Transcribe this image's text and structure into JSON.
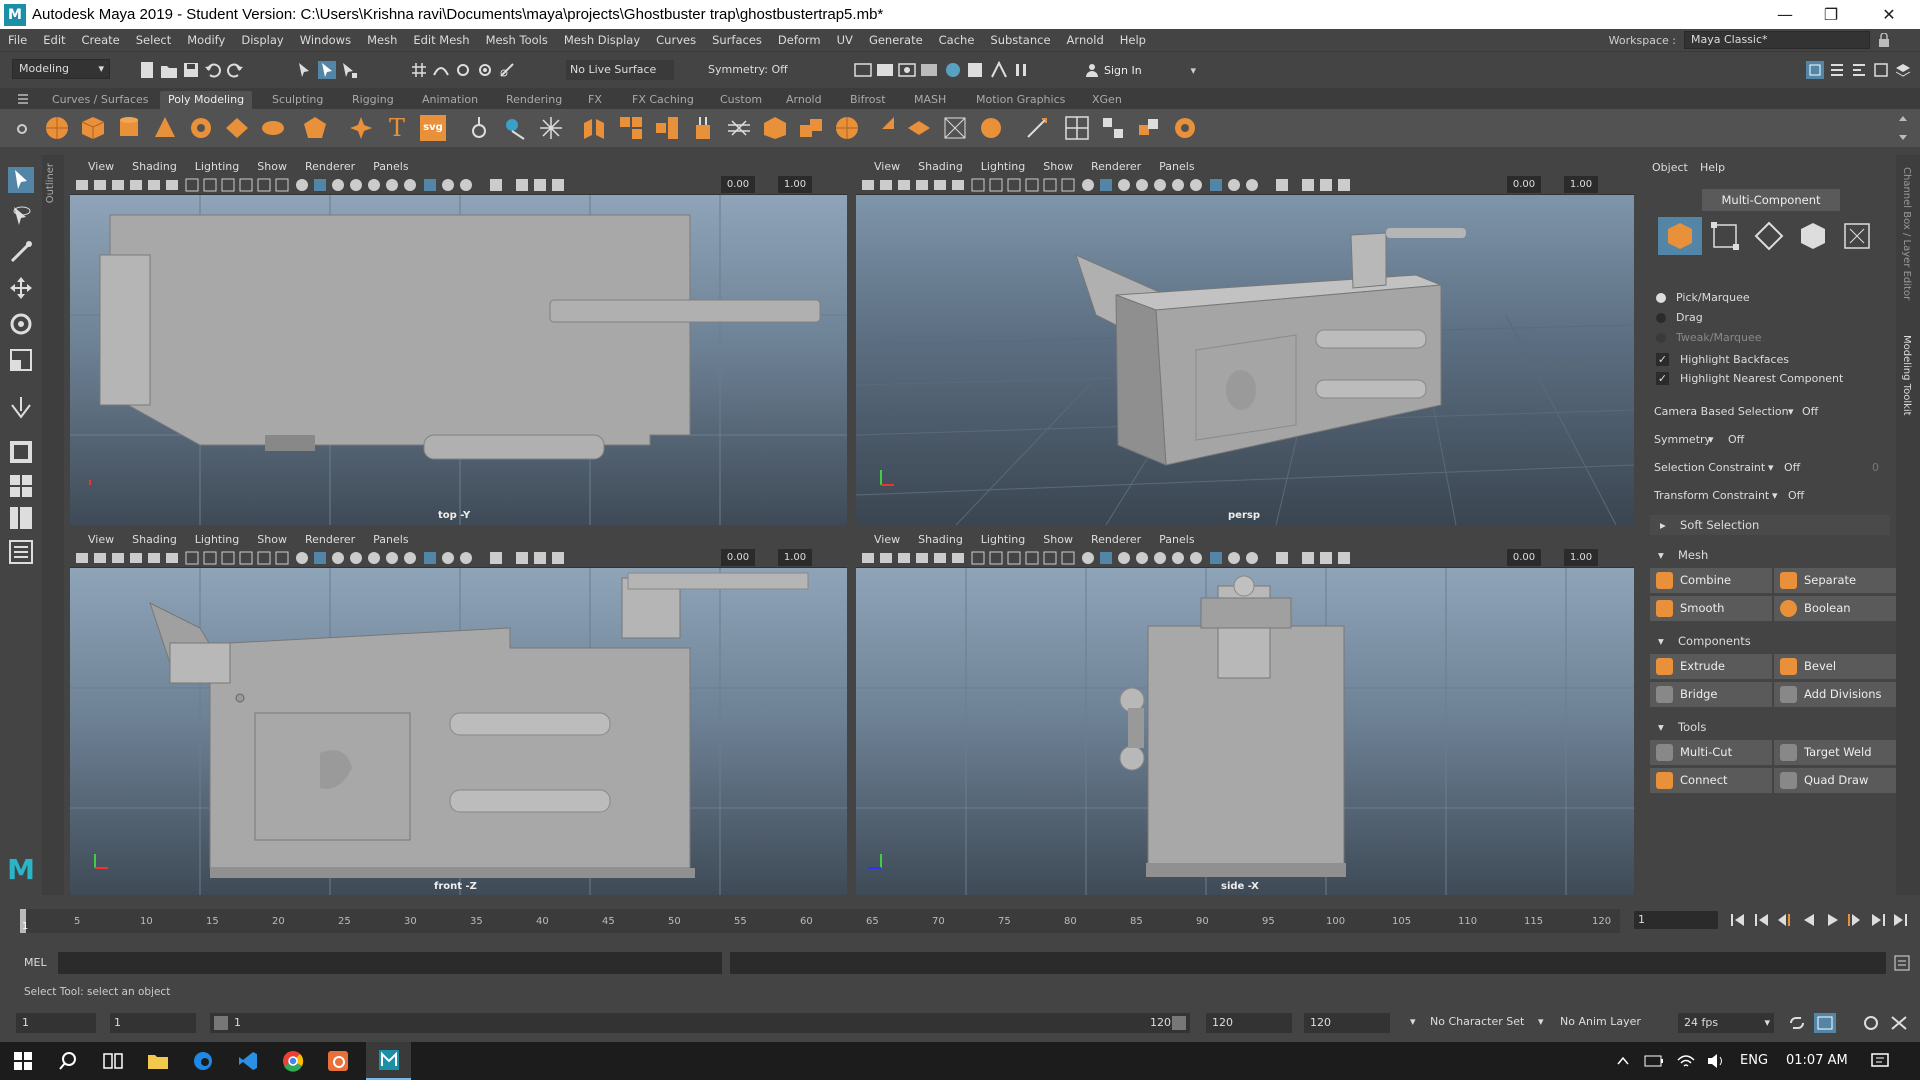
{
  "window": {
    "title": "Autodesk Maya 2019 - Student Version: C:\\Users\\Krishna ravi\\Documents\\maya\\projects\\Ghostbuster trap\\ghostbustertrap5.mb*",
    "logo": "M",
    "minimize": "—",
    "maximize": "❐",
    "close": "✕"
  },
  "menubar": {
    "items": [
      "File",
      "Edit",
      "Create",
      "Select",
      "Modify",
      "Display",
      "Windows",
      "Mesh",
      "Edit Mesh",
      "Mesh Tools",
      "Mesh Display",
      "Curves",
      "Surfaces",
      "Deform",
      "UV",
      "Generate",
      "Cache",
      "Substance",
      "Arnold",
      "Help"
    ],
    "workspace_label": "Workspace :",
    "workspace_value": "Maya Classic*"
  },
  "statusline": {
    "mode": "Modeling",
    "live_surface": "No Live Surface",
    "symmetry": "Symmetry: Off",
    "sign_in": "Sign In"
  },
  "shelf": {
    "tabs": [
      "Curves / Surfaces",
      "Poly Modeling",
      "Sculpting",
      "Rigging",
      "Animation",
      "Rendering",
      "FX",
      "FX Caching",
      "Custom",
      "Arnold",
      "Bifrost",
      "MASH",
      "Motion Graphics",
      "XGen"
    ],
    "active_tab": "Poly Modeling",
    "text_icon": "T",
    "svg_icon": "svg"
  },
  "outliner_label": "Outliner",
  "viewports": {
    "menu": [
      "View",
      "Shading",
      "Lighting",
      "Show",
      "Renderer",
      "Panels"
    ],
    "value_a": "0.00",
    "value_b": "1.00",
    "panels": [
      {
        "label": "top -Y"
      },
      {
        "label": "persp"
      },
      {
        "label": "front -Z"
      },
      {
        "label": "side -X"
      }
    ]
  },
  "modeling_toolkit": {
    "menu": [
      "Object",
      "Help"
    ],
    "mode": "Multi-Component",
    "pick_options": [
      "Pick/Marquee",
      "Drag",
      "Tweak/Marquee"
    ],
    "highlight_backfaces": "Highlight Backfaces",
    "highlight_nearest": "Highlight Nearest Component",
    "camera_based_selection": {
      "label": "Camera Based Selection",
      "value": "Off"
    },
    "symmetry": {
      "label": "Symmetry",
      "value": "Off"
    },
    "selection_constraint": {
      "label": "Selection Constraint",
      "value": "Off",
      "count": "0"
    },
    "transform_constraint": {
      "label": "Transform Constraint",
      "value": "Off"
    },
    "soft_selection": "Soft Selection",
    "mesh": {
      "title": "Mesh",
      "buttons": [
        "Combine",
        "Separate",
        "Smooth",
        "Boolean"
      ]
    },
    "components": {
      "title": "Components",
      "buttons": [
        "Extrude",
        "Bevel",
        "Bridge",
        "Add Divisions"
      ]
    },
    "tools": {
      "title": "Tools",
      "buttons": [
        "Multi-Cut",
        "Target Weld",
        "Connect",
        "Quad Draw"
      ]
    },
    "side_labels": [
      "Channel Box / Layer Editor",
      "Modeling Toolkit"
    ]
  },
  "timeslider": {
    "ticks": [
      "1",
      "5",
      "10",
      "15",
      "20",
      "25",
      "30",
      "35",
      "40",
      "45",
      "50",
      "55",
      "60",
      "65",
      "70",
      "75",
      "80",
      "85",
      "90",
      "95",
      "100",
      "105",
      "110",
      "115",
      "120"
    ],
    "current_frame": "1"
  },
  "commandline": {
    "lang": "MEL",
    "help": "Select Tool: select an object"
  },
  "rangebar": {
    "start": "1",
    "anim_start": "1",
    "range_start": "1",
    "range_end": "120",
    "anim_end": "120",
    "end": "120",
    "character_set": "No Character Set",
    "anim_layer": "No Anim Layer",
    "fps": "24 fps"
  },
  "taskbar": {
    "lang": "ENG",
    "time": "01:07 AM"
  },
  "colors": {
    "accent": "#5285a6",
    "maya_logo": "#1a8fa6",
    "viewport_sky_top": "#8fa4b8",
    "viewport_floor": "#3e4a56",
    "mesh_grey": "#a8a8a8"
  }
}
